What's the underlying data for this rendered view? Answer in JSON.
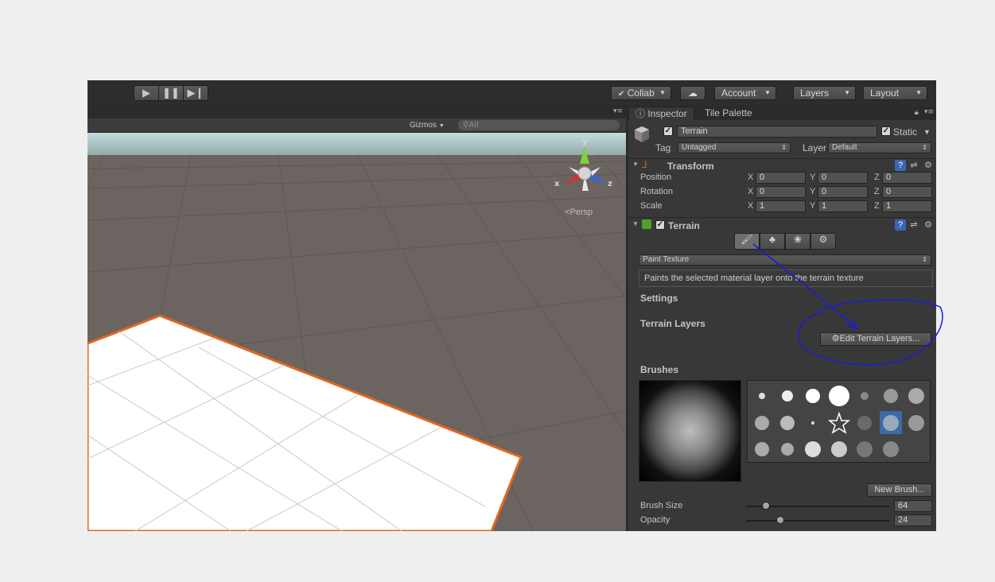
{
  "toolbar": {
    "play_icon": "play-icon",
    "pause_icon": "pause-icon",
    "step_icon": "step-icon",
    "collab_label": "Collab",
    "account_label": "Account",
    "layers_label": "Layers",
    "layout_label": "Layout"
  },
  "scene": {
    "gizmos_label": "Gizmos",
    "search_placeholder": "All",
    "persp_label": "Persp",
    "axis_y": "y",
    "axis_x": "x",
    "axis_z": "z"
  },
  "tabs": {
    "inspector": "Inspector",
    "tile_palette": "Tile Palette"
  },
  "object": {
    "name": "Terrain",
    "static_label": "Static",
    "tag_label": "Tag",
    "tag_value": "Untagged",
    "layer_label": "Layer",
    "layer_value": "Default"
  },
  "transform": {
    "title": "Transform",
    "rows": [
      {
        "label": "Position",
        "x": "0",
        "y": "0",
        "z": "0"
      },
      {
        "label": "Rotation",
        "x": "0",
        "y": "0",
        "z": "0"
      },
      {
        "label": "Scale",
        "x": "1",
        "y": "1",
        "z": "1"
      }
    ],
    "axis_x": "X",
    "axis_y": "Y",
    "axis_z": "Z"
  },
  "terrain": {
    "title": "Terrain",
    "mode_value": "Paint Texture",
    "description": "Paints the selected material layer onto the terrain texture",
    "settings_label": "Settings",
    "layers_label": "Terrain Layers",
    "edit_layers_button": "Edit Terrain Layers...",
    "brushes_label": "Brushes",
    "new_brush_button": "New Brush...",
    "brush_size_label": "Brush Size",
    "brush_size_value": "64",
    "brush_size_fraction": 0.14,
    "opacity_label": "Opacity",
    "opacity_value": "24",
    "opacity_fraction": 0.24
  },
  "colors": {
    "selection_orange": "#e0681e",
    "annotation_blue": "#1a1ae0",
    "ground": "#6b6460"
  }
}
